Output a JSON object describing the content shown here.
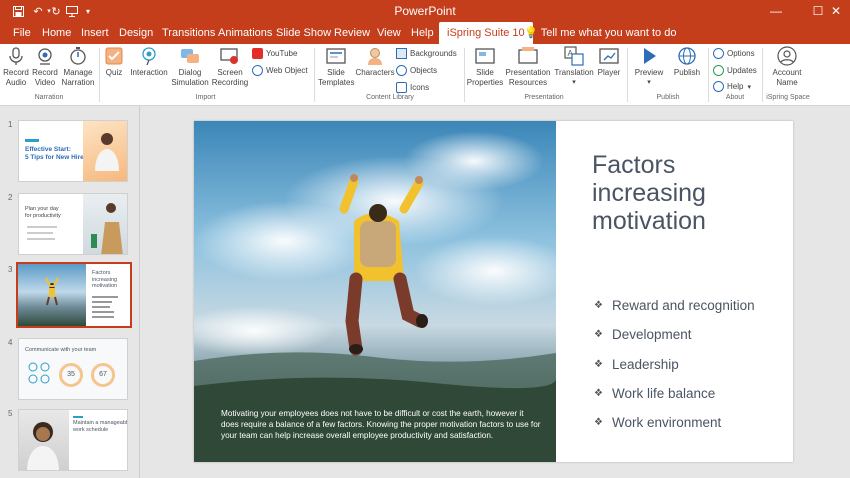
{
  "window": {
    "title": "PowerPoint"
  },
  "quick_access": [
    "save-icon",
    "undo-icon",
    "redo-icon",
    "presentation-icon",
    "customize-icon"
  ],
  "tabs": [
    {
      "label": "File"
    },
    {
      "label": "Home"
    },
    {
      "label": "Insert"
    },
    {
      "label": "Design"
    },
    {
      "label": "Transitions"
    },
    {
      "label": "Animations"
    },
    {
      "label": "Slide Show"
    },
    {
      "label": "Review"
    },
    {
      "label": "View"
    },
    {
      "label": "Help"
    },
    {
      "label": "iSpring Suite 10"
    }
  ],
  "tell_me": "Tell me what you want to do",
  "ribbon": {
    "narration": {
      "record_audio": "Record\nAudio",
      "record_video": "Record\nVideo",
      "manage_narration": "Manage\nNarration",
      "group": "Narration"
    },
    "import": {
      "quiz": "Quiz",
      "interaction": "Interaction",
      "dialog_simulation": "Dialog\nSimulation",
      "screen_recording": "Screen\nRecording",
      "youtube": "YouTube",
      "web_object": "Web Object",
      "group": "Import"
    },
    "content_library": {
      "slide_templates": "Slide\nTemplates",
      "characters": "Characters",
      "backgrounds": "Backgrounds",
      "objects": "Objects",
      "icons": "Icons",
      "group": "Content Library"
    },
    "presentation": {
      "slide_properties": "Slide\nProperties",
      "presentation_resources": "Presentation\nResources",
      "translation": "Translation",
      "player": "Player",
      "group": "Presentation"
    },
    "publish": {
      "preview": "Preview",
      "publish": "Publish",
      "group": "Publish"
    },
    "about": {
      "options": "Options",
      "updates": "Updates",
      "help": "Help",
      "group": "About"
    },
    "ispring_space": {
      "account_name": "Account\nName",
      "group": "iSpring Space"
    }
  },
  "thumbnails": [
    {
      "num": "1",
      "title": "Effective Start:\n5 Tips for New Hires"
    },
    {
      "num": "2",
      "title": "Plan your day\nfor productivity"
    },
    {
      "num": "3",
      "title": "Factors\nincreasing\nmotivation",
      "selected": true
    },
    {
      "num": "4",
      "title": "Communicate with your team",
      "stat1": "35",
      "stat2": "67"
    },
    {
      "num": "5",
      "title": "Maintain a manageable\nwork schedule"
    }
  ],
  "slide": {
    "title": "Factors increasing motivation",
    "bullets": [
      "Reward and recognition",
      "Development",
      "Leadership",
      "Work life balance",
      "Work environment"
    ],
    "caption": "Motivating your employees does not have to be difficult or cost the earth, however it does require a balance of a few factors. Knowing the proper motivation factors to use for your team can help increase overall employee productivity and satisfaction."
  },
  "colors": {
    "accent": "#c43e1c",
    "slide_text": "#4a5563"
  }
}
